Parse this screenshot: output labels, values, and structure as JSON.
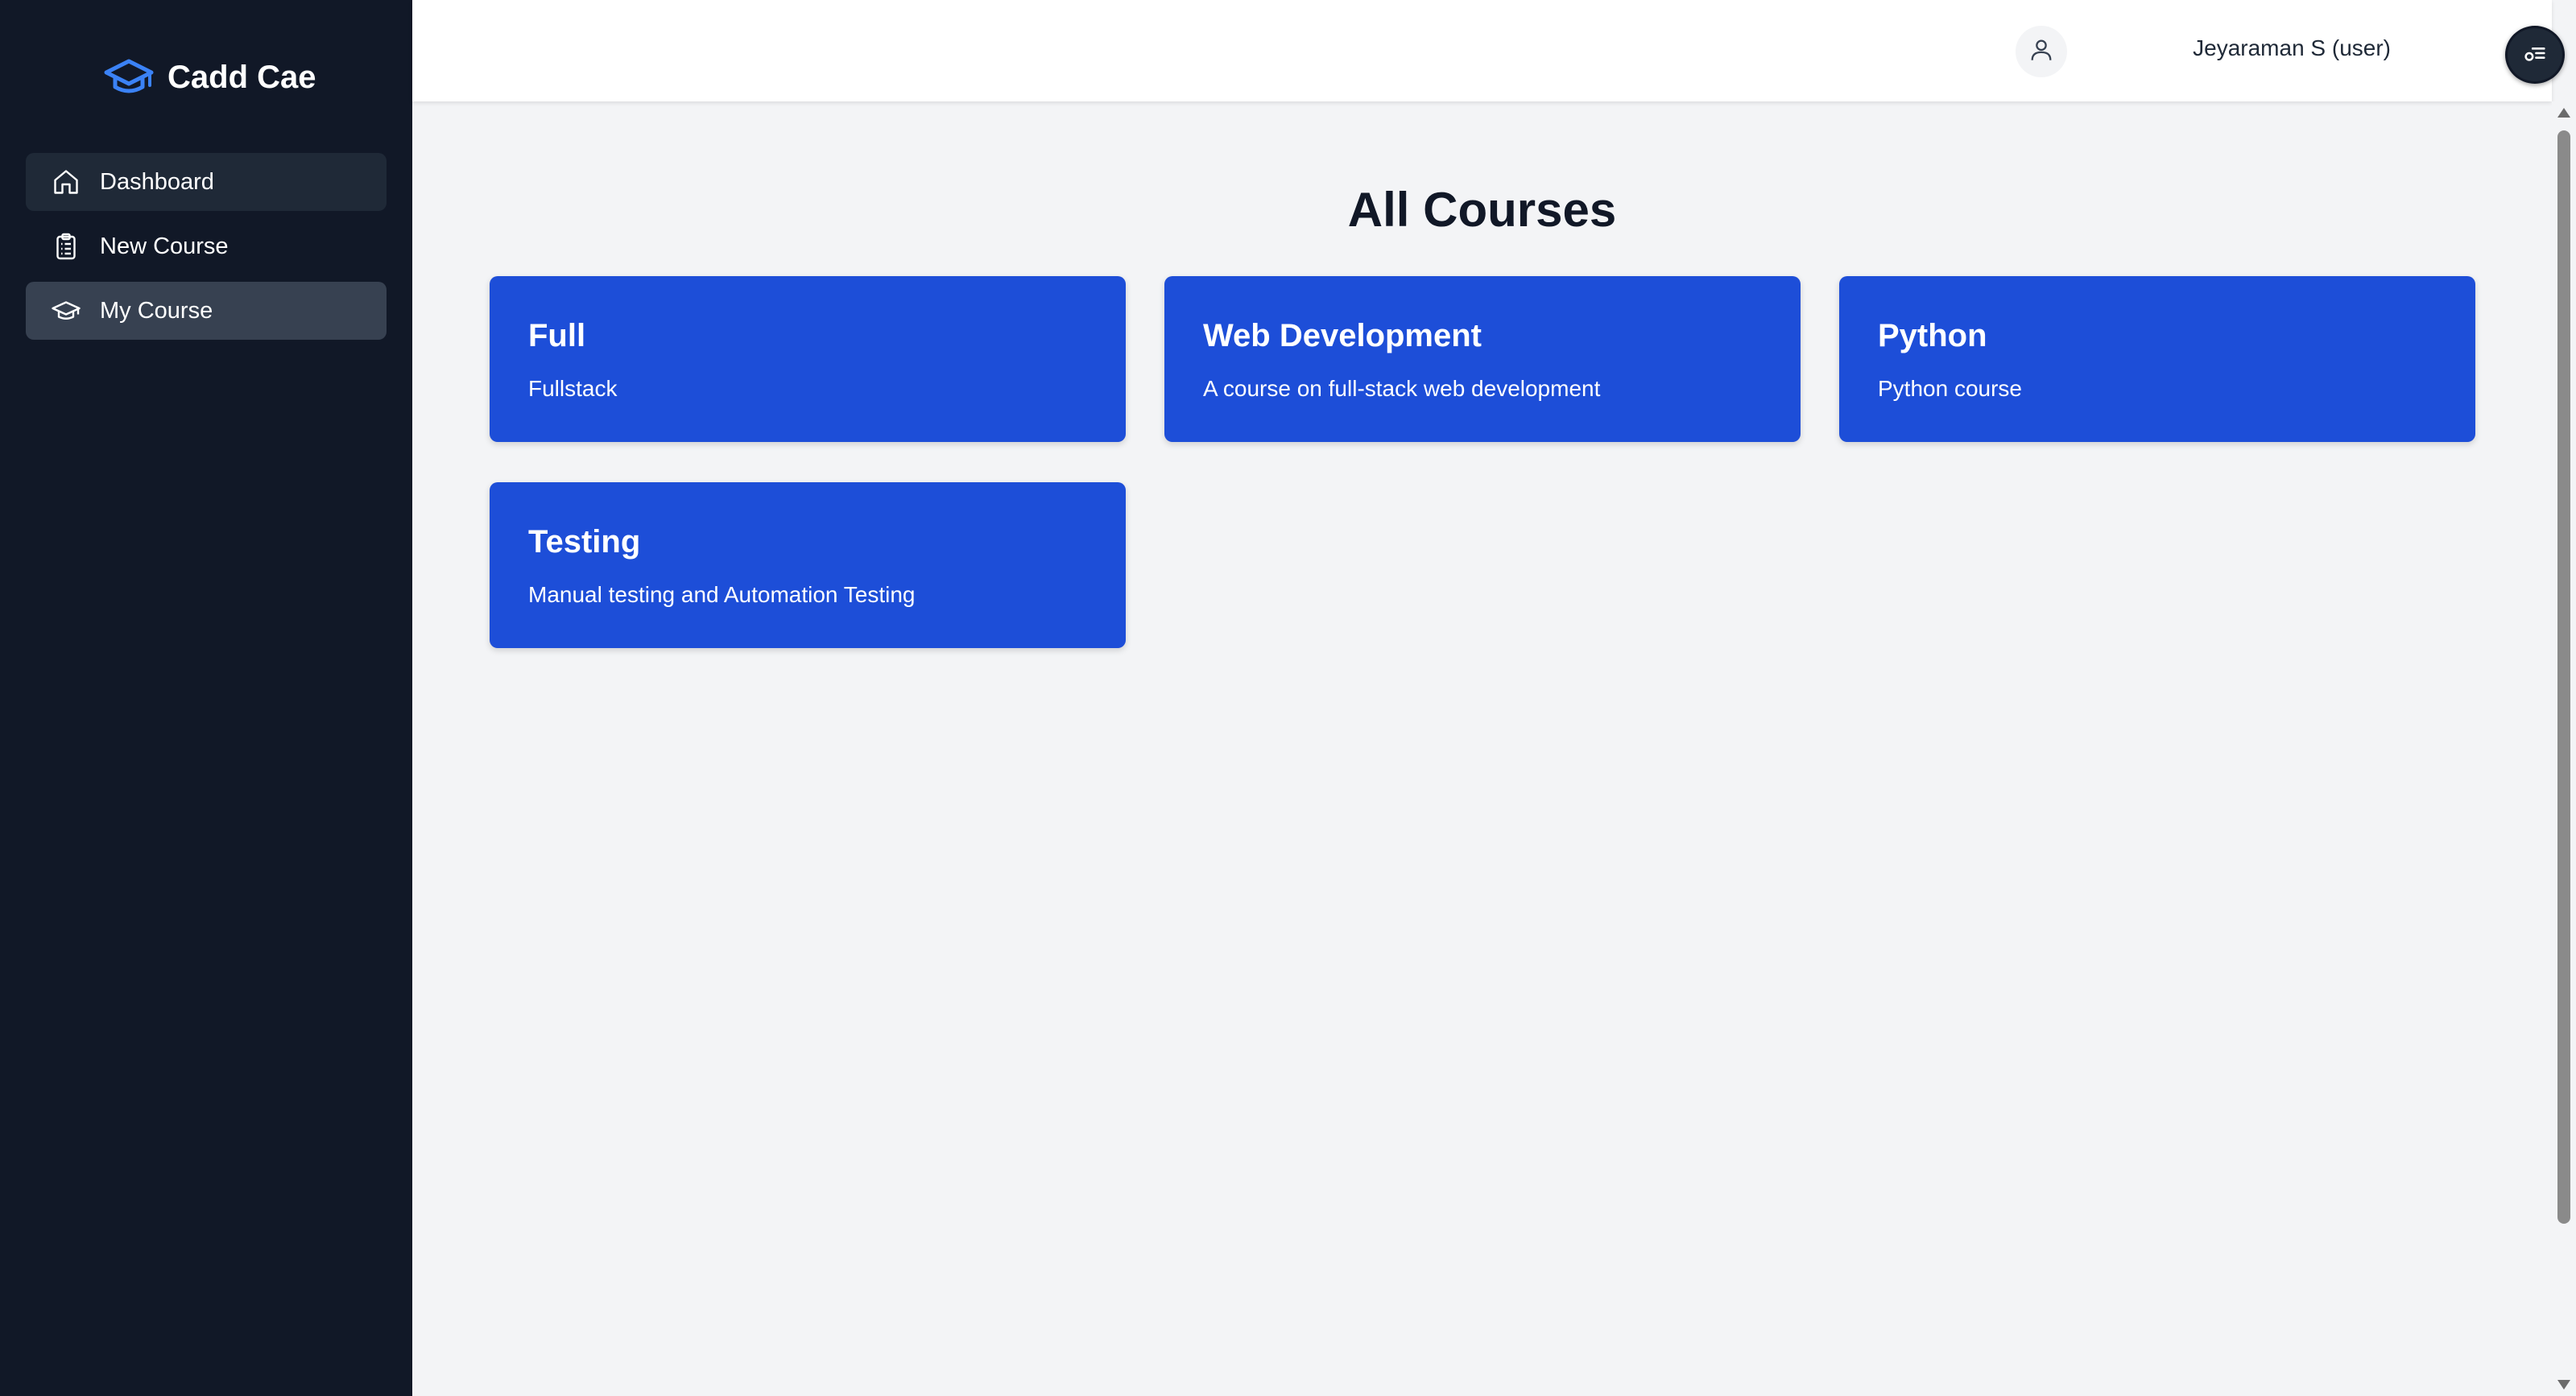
{
  "brand": {
    "name": "Cadd Cae",
    "icon": "graduation-cap-icon",
    "icon_color": "#3b82f6"
  },
  "sidebar": {
    "items": [
      {
        "label": "Dashboard",
        "icon": "home-icon"
      },
      {
        "label": "New Course",
        "icon": "clipboard-icon"
      },
      {
        "label": "My Course",
        "icon": "graduation-cap-icon",
        "active": true
      }
    ]
  },
  "header": {
    "user_name": "Jeyaraman S (user)",
    "avatar_icon": "user-icon",
    "menu_icon": "menu-key-icon"
  },
  "main": {
    "title": "All Courses",
    "courses": [
      {
        "title": "Full",
        "description": "Fullstack"
      },
      {
        "title": "Web Development",
        "description": "A course on full-stack web development"
      },
      {
        "title": "Python",
        "description": "Python course"
      },
      {
        "title": "Testing",
        "description": "Manual testing and Automation Testing"
      }
    ]
  },
  "colors": {
    "sidebar_bg": "#111827",
    "card_bg": "#1d4ed8",
    "page_bg": "#f3f4f6",
    "accent": "#3b82f6"
  }
}
